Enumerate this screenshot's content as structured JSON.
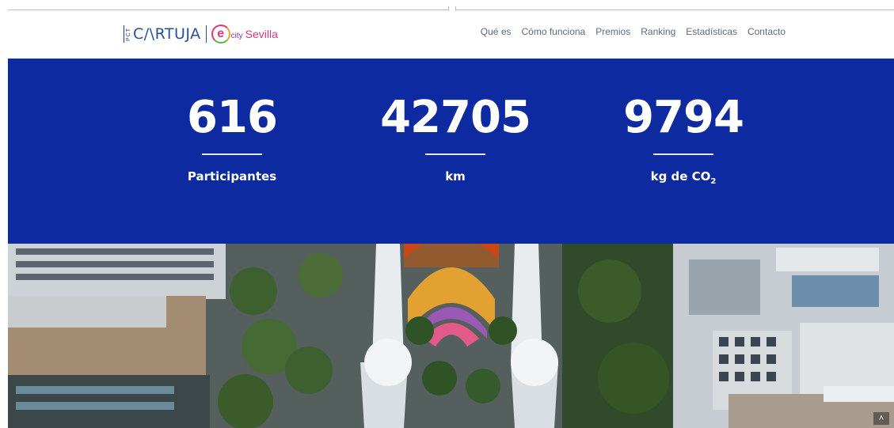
{
  "header": {
    "logo_pct": "PCT",
    "logo_cartuja": "C/\\RTUJA",
    "logo_e": "e",
    "logo_city": "city",
    "logo_sevilla": "Sevilla"
  },
  "nav": {
    "items": [
      "Qué es",
      "Cómo funciona",
      "Premios",
      "Ranking",
      "Estadísticas",
      "Contacto"
    ]
  },
  "stats": [
    {
      "value": "616",
      "label": "Participantes"
    },
    {
      "value": "42705",
      "label": "km"
    },
    {
      "value": "9794",
      "label_main": "kg de CO",
      "label_sub": "2"
    }
  ],
  "scroll_top": {
    "glyph": "˄"
  },
  "colors": {
    "stats_bg": "#0e2aa0",
    "nav_text": "#5c6b80",
    "brand_blue": "#2b4e98",
    "ecity_pink": "#d8367a"
  }
}
